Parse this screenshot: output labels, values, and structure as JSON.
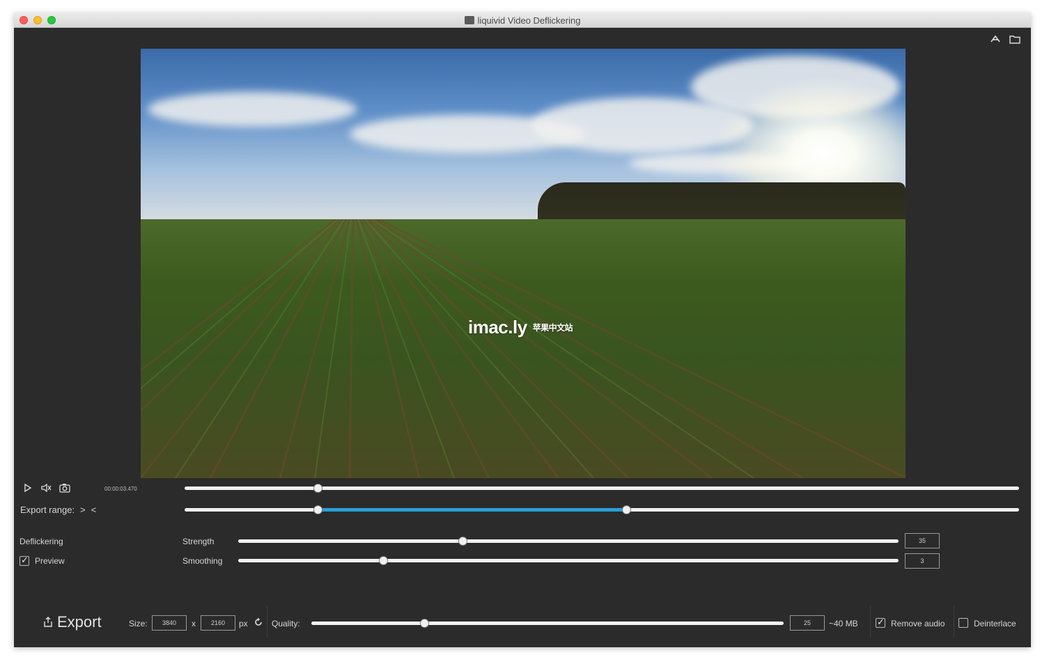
{
  "window": {
    "title": "liquivid Video Deflickering"
  },
  "player": {
    "timecode": "00:00:03.470",
    "playhead_fraction": 0.16
  },
  "export_range": {
    "label": "Export range:",
    "next_symbol": ">",
    "prev_symbol": "<",
    "start_fraction": 0.16,
    "end_fraction": 0.53,
    "accent_color": "#2aa0d6"
  },
  "deflickering": {
    "section_label": "Deflickering",
    "preview_label": "Preview",
    "preview_checked": true,
    "strength": {
      "label": "Strength",
      "value": "35",
      "fraction": 0.34
    },
    "smoothing": {
      "label": "Smoothing",
      "value": "3",
      "fraction": 0.22
    }
  },
  "export_bar": {
    "export_label": "Export",
    "size_label": "Size:",
    "width": "3840",
    "x_label": "x",
    "height": "2160",
    "unit": "px",
    "quality_label": "Quality:",
    "quality_value": "25",
    "quality_fraction": 0.24,
    "estimated_size": "~40 MB",
    "remove_audio_label": "Remove audio",
    "remove_audio_checked": true,
    "deinterlace_label": "Deinterlace",
    "deinterlace_checked": false
  },
  "watermark": {
    "text": "imac.ly",
    "subtext": "苹果中文站"
  },
  "icons": [
    "play-icon",
    "volume-icon",
    "camera-icon",
    "share-icon",
    "folder-icon",
    "export-icon",
    "reset-icon"
  ]
}
